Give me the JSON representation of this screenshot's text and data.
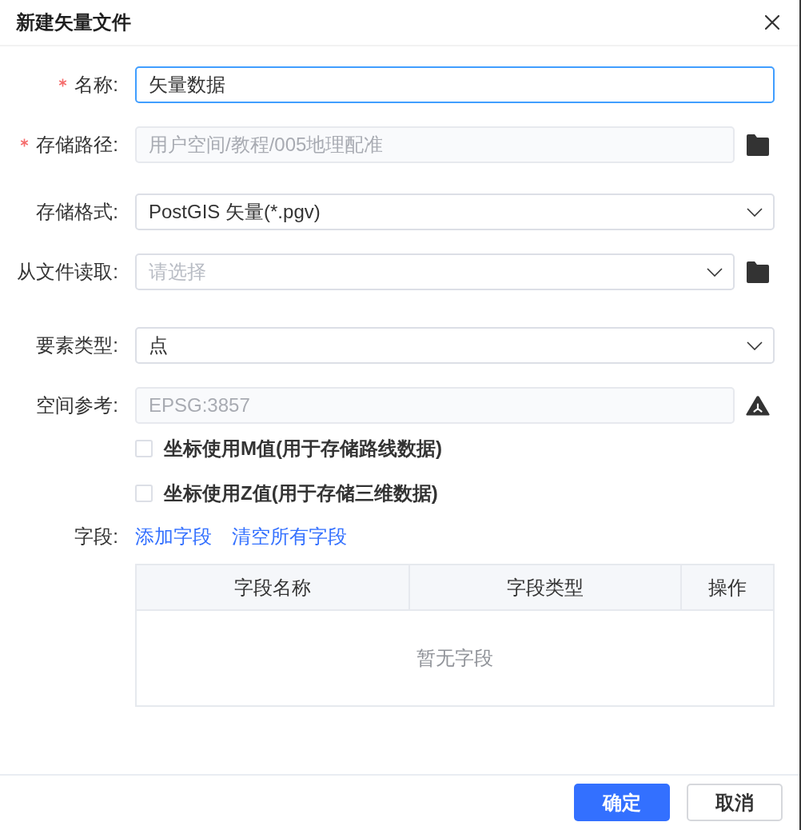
{
  "dialog": {
    "title": "新建矢量文件"
  },
  "form": {
    "rows": [
      {
        "kind": "input",
        "label": "名称:",
        "required": true,
        "value": "矢量数据",
        "focused": true,
        "disabled": false
      },
      {
        "kind": "path-input",
        "label": "存储路径:",
        "required": true,
        "value": "用户空间/教程/005地理配准",
        "focused": false,
        "disabled": true
      },
      {
        "kind": "select",
        "label": "存储格式:",
        "required": false,
        "value": "PostGIS 矢量(*.pgv)",
        "focused": false,
        "disabled": false
      },
      {
        "kind": "file-select",
        "label": "从文件读取:",
        "required": false,
        "placeholder": "请选择",
        "focused": false,
        "disabled": false
      },
      {
        "kind": "select",
        "label": "要素类型:",
        "required": false,
        "value": "点",
        "focused": false,
        "disabled": false
      },
      {
        "kind": "crs-input",
        "label": "空间参考:",
        "required": false,
        "value": "EPSG:3857",
        "focused": false,
        "disabled": true
      }
    ],
    "checkboxes": [
      {
        "label": "坐标使用M值(用于存储路线数据)",
        "checked": false
      },
      {
        "label": "坐标使用Z值(用于存储三维数据)",
        "checked": false
      }
    ],
    "fields": {
      "label": "字段:",
      "links": [
        "添加字段",
        "清空所有字段"
      ],
      "table": {
        "columns": [
          "字段名称",
          "字段类型",
          "操作"
        ],
        "empty_text": "暂无字段"
      }
    }
  },
  "footer": {
    "buttons": [
      {
        "label": "确定",
        "kind": "primary"
      },
      {
        "label": "取消",
        "kind": "default"
      }
    ]
  }
}
